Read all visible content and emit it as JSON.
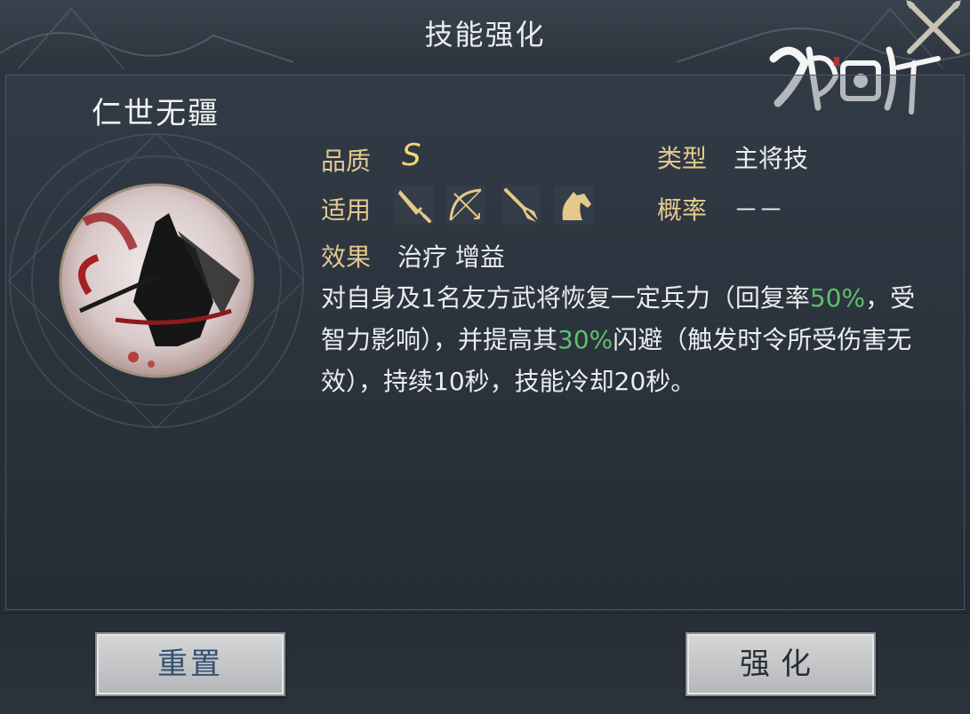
{
  "header": {
    "title": "技能强化"
  },
  "skill": {
    "name": "仁世无疆",
    "quality_label": "品质",
    "quality_value": "S",
    "type_label": "类型",
    "type_value": "主将技",
    "apply_label": "适用",
    "apply_icons": [
      "sword-icon",
      "bow-icon",
      "spear-icon",
      "horse-icon"
    ],
    "chance_label": "概率",
    "chance_value": "－－",
    "effect_label": "效果",
    "effect_value": "治疗 增益",
    "description": {
      "part1": "对自身及1名友方武将恢复一定兵力（回复率",
      "highlight1": "50%",
      "part2": "，受智力影响），并提高其",
      "highlight2": "30%",
      "part3": "闪避（触发时令所受伤害无效），持续10秒，技能冷却20秒。"
    }
  },
  "buttons": {
    "reset_label": "重置",
    "enhance_label": "强化"
  },
  "colors": {
    "label_gold": "#e3c98e",
    "highlight_green": "#5fbf6c",
    "background": "#28303a"
  }
}
